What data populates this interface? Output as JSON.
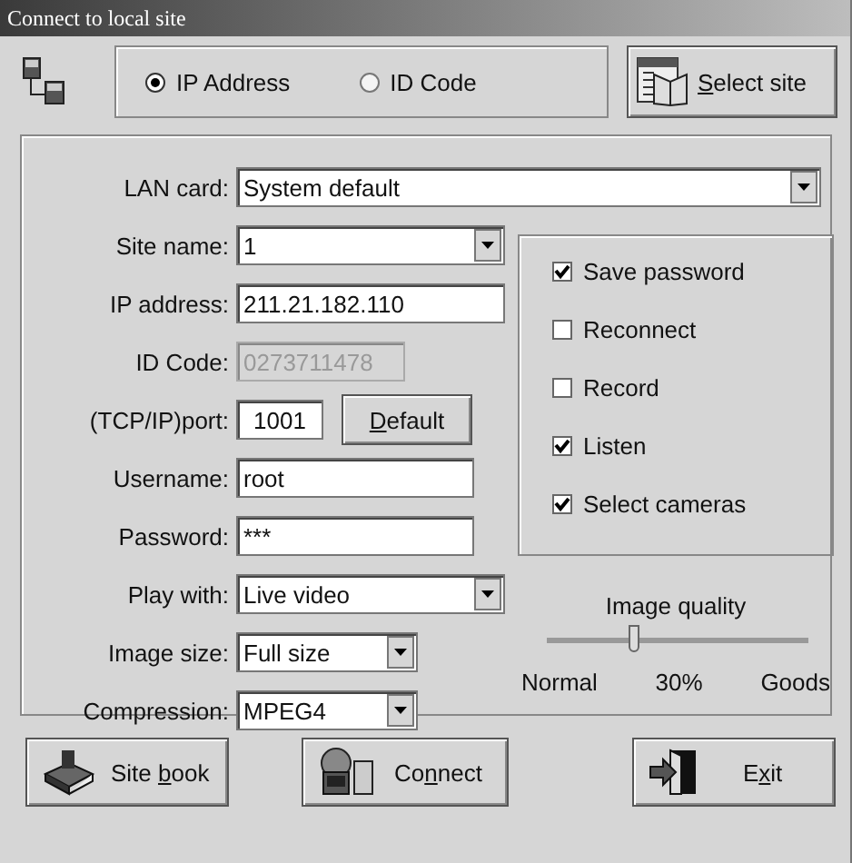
{
  "window": {
    "title": "Connect to local site"
  },
  "mode": [
    {
      "label": "IP Address",
      "selected": true
    },
    {
      "label": "ID Code",
      "selected": false
    }
  ],
  "select_site_button": {
    "key": "S",
    "after": "elect site"
  },
  "fields": [
    {
      "label": "LAN card:",
      "value": "System default",
      "kind": "dropdown",
      "disabled": false
    },
    {
      "label": "Site name:",
      "value": "1",
      "kind": "dropdown",
      "disabled": false
    },
    {
      "label": "IP address:",
      "value": "211.21.182.110",
      "kind": "text",
      "disabled": false
    },
    {
      "label": "ID Code:",
      "value": "0273711478",
      "kind": "text",
      "disabled": true
    },
    {
      "label": "(TCP/IP)port:",
      "value": "1001",
      "kind": "port",
      "disabled": false
    },
    {
      "label": "Username:",
      "value": "root",
      "kind": "text",
      "disabled": false
    },
    {
      "label": "Password:",
      "value": "***",
      "kind": "text",
      "disabled": false
    },
    {
      "label": "Play with:",
      "value": "Live video",
      "kind": "dropdown",
      "disabled": false
    },
    {
      "label": "Image size:",
      "value": "Full size",
      "kind": "dropdown",
      "disabled": false
    },
    {
      "label": "Compression:",
      "value": "MPEG4",
      "kind": "dropdown",
      "disabled": false
    }
  ],
  "default_button": {
    "key": "D",
    "after": "efault"
  },
  "options": [
    {
      "label": "Save password",
      "checked": true
    },
    {
      "label": "Reconnect",
      "checked": false
    },
    {
      "label": "Record",
      "checked": false
    },
    {
      "label": "Listen",
      "checked": true
    },
    {
      "label": "Select cameras",
      "checked": true
    }
  ],
  "image_quality": {
    "title": "Image quality",
    "level": 0.33,
    "min_label": "Normal",
    "reading": "30%",
    "max_label": "Goods"
  },
  "buttons": [
    {
      "kind": "book",
      "before": "Site ",
      "key": "b",
      "after": "ook"
    },
    {
      "kind": "connect",
      "before": "Co",
      "key": "n",
      "after": "nect"
    },
    {
      "kind": "exit",
      "before": "E",
      "key": "x",
      "after": "it"
    }
  ]
}
